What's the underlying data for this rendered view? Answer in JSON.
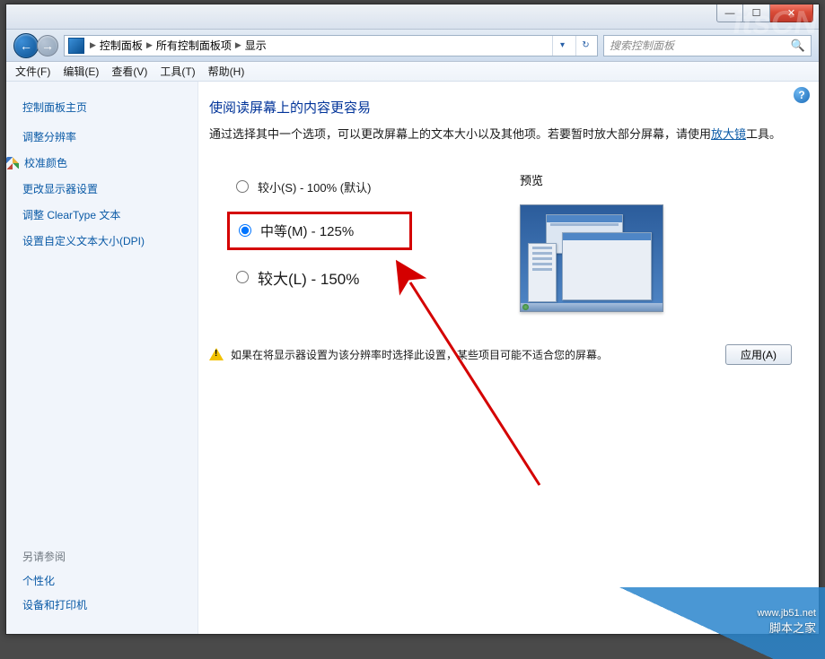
{
  "title": {
    "btn_min": "—",
    "btn_max": "☐",
    "btn_close": "✕"
  },
  "nav": {
    "back": "←",
    "fwd": "→",
    "crumbs": [
      "控制面板",
      "所有控制面板项",
      "显示"
    ],
    "sep": "▶",
    "drop": "▾",
    "refresh": "↻",
    "search_placeholder": "搜索控制面板"
  },
  "menu": [
    "文件(F)",
    "编辑(E)",
    "查看(V)",
    "工具(T)",
    "帮助(H)"
  ],
  "sidebar": {
    "home": "控制面板主页",
    "links": [
      {
        "label": "调整分辨率",
        "shield": false
      },
      {
        "label": "校准颜色",
        "shield": true
      },
      {
        "label": "更改显示器设置",
        "shield": false
      },
      {
        "label": "调整 ClearType 文本",
        "shield": false
      },
      {
        "label": "设置自定义文本大小(DPI)",
        "shield": false
      }
    ],
    "footer_head": "另请参阅",
    "footer_links": [
      "个性化",
      "设备和打印机"
    ]
  },
  "main": {
    "help": "?",
    "title": "使阅读屏幕上的内容更容易",
    "desc_a": "通过选择其中一个选项，可以更改屏幕上的文本大小以及其他项。若要暂时放大部分屏幕，请使用",
    "desc_link": "放大镜",
    "desc_b": "工具。",
    "options": [
      {
        "id": "small",
        "label": "较小(S) - 100% (默认)",
        "checked": false
      },
      {
        "id": "medium",
        "label": "中等(M) - 125%",
        "checked": true
      },
      {
        "id": "large",
        "label": "较大(L) - 150%",
        "checked": false
      }
    ],
    "preview_label": "预览",
    "warning": "如果在将显示器设置为该分辨率时选择此设置，某些项目可能不适合您的屏幕。",
    "apply": "应用(A)"
  },
  "watermark": {
    "top": "itsCN",
    "url": "www.jb51.net",
    "name": "脚本之家"
  }
}
